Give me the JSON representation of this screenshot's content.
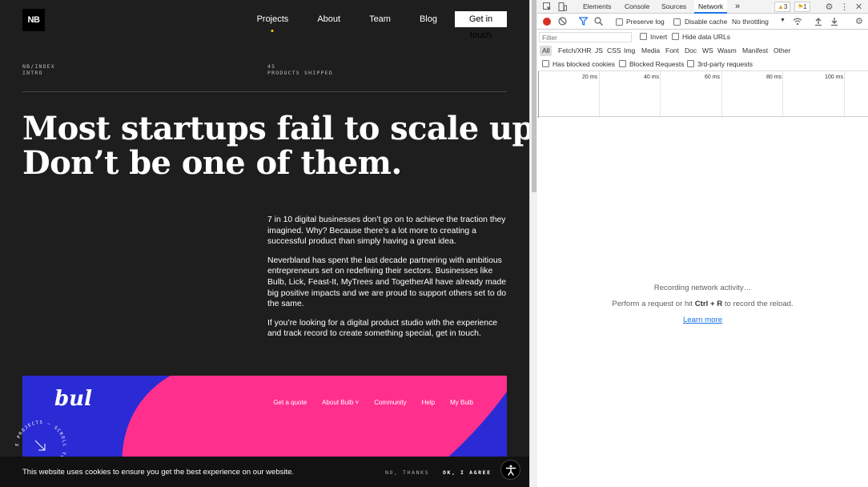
{
  "site": {
    "logo": "NB",
    "nav": [
      "Projects",
      "About",
      "Team",
      "Blog"
    ],
    "cta": "Get in touch",
    "meta_left": [
      "NB/INDEX",
      "INTRO"
    ],
    "meta_right": [
      "45",
      "PRODUCTS SHIPPED"
    ],
    "headline": [
      "Most startups fail to scale up.",
      "Don’t be one of them."
    ],
    "paragraphs": [
      "7 in 10 digital businesses don’t go on to achieve the traction they imagined. Why? Because there’s a lot more to creating a successful product than simply having a great idea.",
      "Neverbland has spent the last decade partnering with ambitious entrepreneurs set on redefining their sectors. Businesses like Bulb, Lick, Feast-It, MyTrees and TogetherAll have already made big positive impacts and we are proud to support others set to do the same.",
      "If you’re looking for a digital product studio with the experience and track record to create something special, get in touch."
    ],
    "bulb_logo": "bul",
    "bulb_nav": [
      "Get a quote",
      "About Bulb ˅",
      "Community",
      "Help",
      "My Bulb"
    ],
    "scroll_badge": "E PROJECTS — SCROLL TO SEE PRO",
    "cookie_text": "This website uses cookies to ensure you get the best experience on our website.",
    "cookie_decline": "NO, THANKS",
    "cookie_accept": "OK, I AGREE",
    "colors": {
      "bg": "#1e1e1e",
      "accent_dot": "#ffd400",
      "bulb_pink": "#ff2f8e",
      "bulb_blue": "#2a2bd4"
    }
  },
  "devtools": {
    "tabs": [
      "Elements",
      "Console",
      "Sources",
      "Network"
    ],
    "more": "»",
    "warnings": "3",
    "issues": "1",
    "preserve_log": "Preserve log",
    "disable_cache": "Disable cache",
    "throttling": "No throttling",
    "filter_placeholder": "Filter",
    "invert": "Invert",
    "hide_data_urls": "Hide data URLs",
    "types": [
      "All",
      "Fetch/XHR",
      "JS",
      "CSS",
      "Img",
      "Media",
      "Font",
      "Doc",
      "WS",
      "Wasm",
      "Manifest",
      "Other"
    ],
    "has_blocked_cookies": "Has blocked cookies",
    "blocked_requests": "Blocked Requests",
    "third_party": "3rd-party requests",
    "ticks": [
      "20 ms",
      "40 ms",
      "60 ms",
      "80 ms",
      "100 ms"
    ],
    "empty_title": "Recording network activity…",
    "empty_pre": "Perform a request or hit",
    "empty_key": "Ctrl + R",
    "empty_post": "to record the reload.",
    "learn_more": "Learn more"
  }
}
